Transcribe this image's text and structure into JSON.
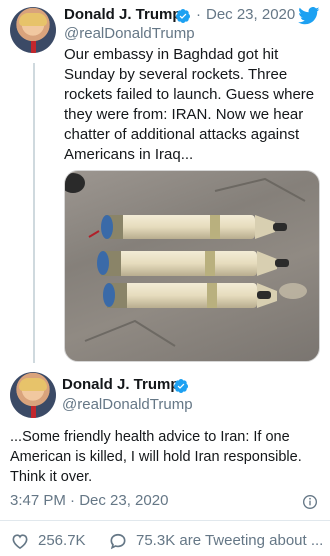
{
  "tweet1": {
    "name": "Donald J. Trump",
    "handle": "@realDonaldTrump",
    "separator": "·",
    "date": "Dec 23, 2020",
    "text": "Our embassy in Baghdad got hit\nSunday by several rockets. Three\nrockets failed to launch. Guess where\nthey were from: IRAN. Now we hear\nchatter of additional attacks against\nAmericans in Iraq..."
  },
  "tweet2": {
    "name": "Donald J. Trump",
    "handle": "@realDonaldTrump",
    "text": "...Some friendly health advice to Iran: If one\nAmerican is killed, I will hold Iran responsible.\nThink it over.",
    "timestamp": "3:47 PM · Dec 23, 2020"
  },
  "stats": {
    "likes": "256.7K",
    "tweeting": "75.3K are Tweeting about ..."
  },
  "colors": {
    "accent": "#1da1f2",
    "text": "#14171a",
    "muted": "#657786"
  },
  "icons": [
    "twitter-bird-icon",
    "verified-badge-icon",
    "info-icon",
    "heart-icon",
    "speech-bubble-icon"
  ]
}
